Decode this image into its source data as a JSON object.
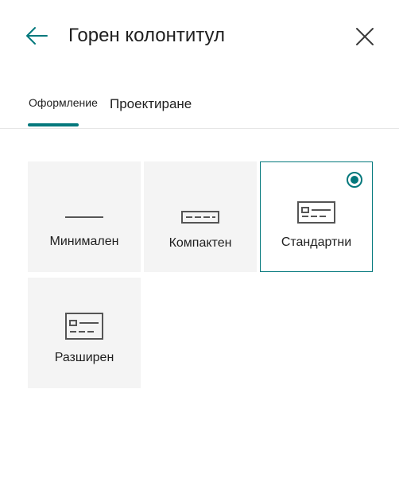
{
  "panel": {
    "title": "Горен колонтитул"
  },
  "tabs": [
    {
      "label": "Оформление",
      "selected": true
    },
    {
      "label": "Проектиране",
      "selected": false
    }
  ],
  "layouts": [
    {
      "label": "Минимален",
      "icon": "minimal-layout-icon",
      "selected": false
    },
    {
      "label": "Компактен",
      "icon": "compact-layout-icon",
      "selected": false
    },
    {
      "label": "Стандартни",
      "icon": "standard-layout-icon",
      "selected": true
    },
    {
      "label": "Разширен",
      "icon": "extended-layout-icon",
      "selected": false
    }
  ],
  "colors": {
    "accent": "#03787c",
    "tile_background": "#f4f4f4"
  }
}
